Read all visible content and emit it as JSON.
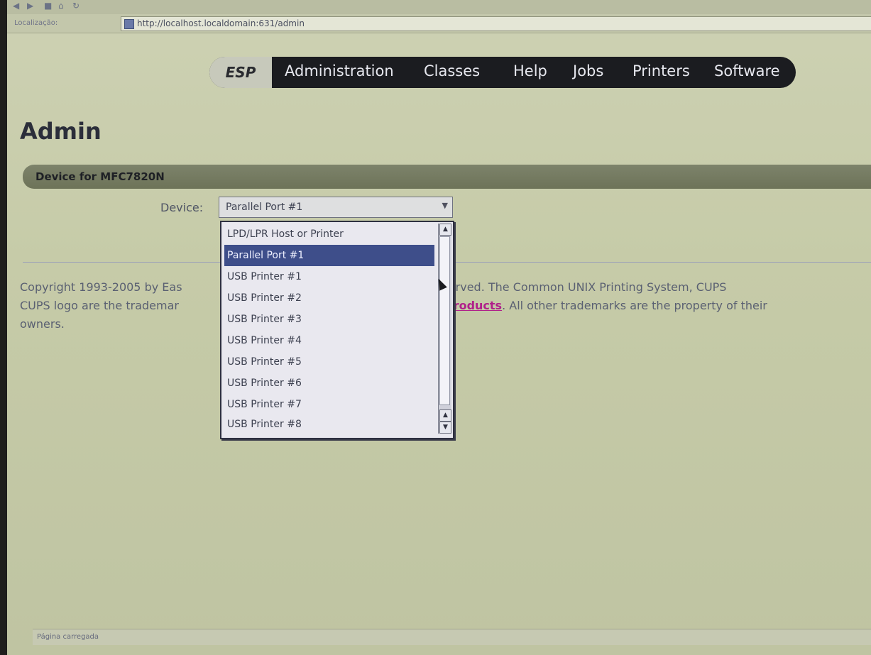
{
  "browser": {
    "toolbar_icons": [
      "back-icon",
      "forward-icon",
      "stop-icon",
      "home-icon",
      "reload-icon"
    ],
    "location_label": "Localização:",
    "url": "http://localhost.localdomain:631/admin",
    "status": "Página carregada"
  },
  "nav": {
    "esp": "ESP",
    "items": [
      "Administration",
      "Classes",
      "Help",
      "Jobs",
      "Printers",
      "Software"
    ]
  },
  "page": {
    "title": "Admin",
    "section_title": "Device for MFC7820N",
    "device_label": "Device:",
    "device_selected": "Parallel Port #1",
    "device_options": [
      "LPD/LPR Host or Printer",
      "Parallel Port #1",
      "USB Printer #1",
      "USB Printer #2",
      "USB Printer #3",
      "USB Printer #4",
      "USB Printer #5",
      "USB Printer #6",
      "USB Printer #7",
      "USB Printer #8"
    ],
    "copyright_line1_a": "Copyright 1993-2005 by Eas",
    "copyright_line1_b": "ts Reserved. The Common UNIX Printing System, CUPS",
    "copyright_line2_a": "CUPS logo are the trademar",
    "copyright_link": "Products",
    "copyright_line2_b": ". All other trademarks are the property of their",
    "copyright_line3": "owners."
  }
}
